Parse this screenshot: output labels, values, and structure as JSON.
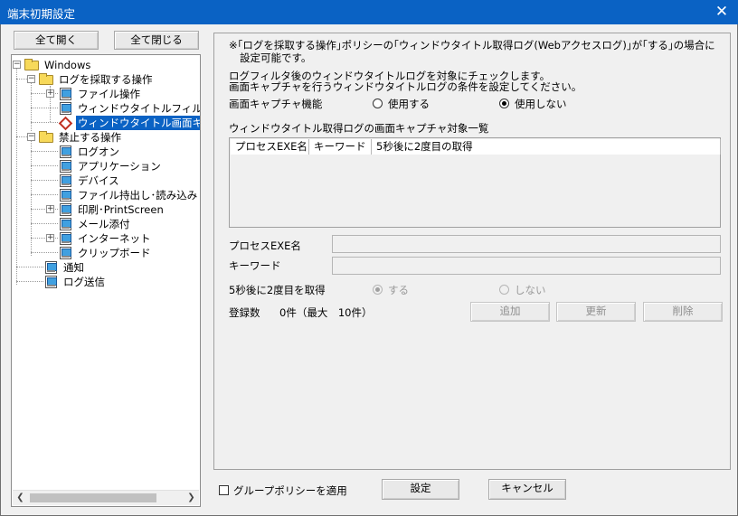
{
  "window": {
    "title": "端末初期設定",
    "close_glyph": "✕"
  },
  "tree_buttons": {
    "expand_all": "全て開く",
    "collapse_all": "全て閉じる"
  },
  "tree": {
    "root": "Windows",
    "log_ops": "ログを採取する操作",
    "file_ops": "ファイル操作",
    "window_title_filter": "ウィンドウタイトルフィルタ",
    "window_title_capture": "ウィンドウタイトル画面キャ",
    "prohibited_ops": "禁止する操作",
    "logon": "ログオン",
    "application": "アプリケーション",
    "device": "デバイス",
    "file_io": "ファイル持出し･読み込み",
    "print": "印刷･PrintScreen",
    "mail": "メール添付",
    "internet": "インターネット",
    "clipboard": "クリップボード",
    "notify": "通知",
    "log_send": "ログ送信"
  },
  "panel": {
    "note_line1": "※｢ログを採取する操作｣ポリシーの｢ウィンドウタイトル取得ログ(Webアクセスログ)｣が｢する｣の場合に",
    "note_line2": "設定可能です。",
    "desc_line1": "ログフィルタ後のウィンドウタイトルログを対象にチェックします。",
    "desc_line2": "画面キャプチャを行うウィンドウタイトルログの条件を設定してください。",
    "capture_label": "画面キャプチャ機能",
    "capture_use": "使用する",
    "capture_nouse": "使用しない",
    "capture_selected": "使用しない",
    "list_title": "ウィンドウタイトル取得ログの画面キャプチャ対象一覧",
    "columns": [
      "プロセスEXE名",
      "キーワード",
      "5秒後に2度目の取得"
    ],
    "rows": [],
    "process_label": "プロセスEXE名",
    "keyword_label": "キーワード",
    "second_label": "5秒後に2度目を取得",
    "second_yes": "する",
    "second_no": "しない",
    "second_selected": "する",
    "count_label": "登録数",
    "count_value": "0件（最大　10件）",
    "add_button": "追加",
    "update_button": "更新",
    "delete_button": "削除"
  },
  "footer": {
    "group_policy_label": "グループポリシーを適用",
    "group_policy_checked": false,
    "ok_button": "設定",
    "cancel_button": "キャンセル"
  },
  "colors": {
    "titlebar": "#0a62c4",
    "selection": "#0a62c4",
    "window_bg": "#f0f0f0"
  }
}
